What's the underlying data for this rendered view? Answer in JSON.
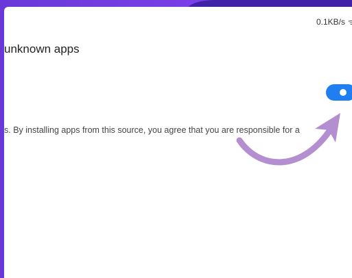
{
  "status_bar": {
    "network_speed": "0.1KB/s",
    "wifi_icon": "wifi-icon"
  },
  "page": {
    "title": "unknown apps",
    "warning_text": "s. By installing apps from this source, you agree that you are responsible for a"
  },
  "toggle": {
    "state": "on",
    "color": "#1f7ff2"
  },
  "annotation": {
    "arrow_color": "#b48fd0",
    "icon": "curved-arrow-icon"
  },
  "colors": {
    "frame": "#7c3ee0",
    "screen": "#ffffff"
  }
}
